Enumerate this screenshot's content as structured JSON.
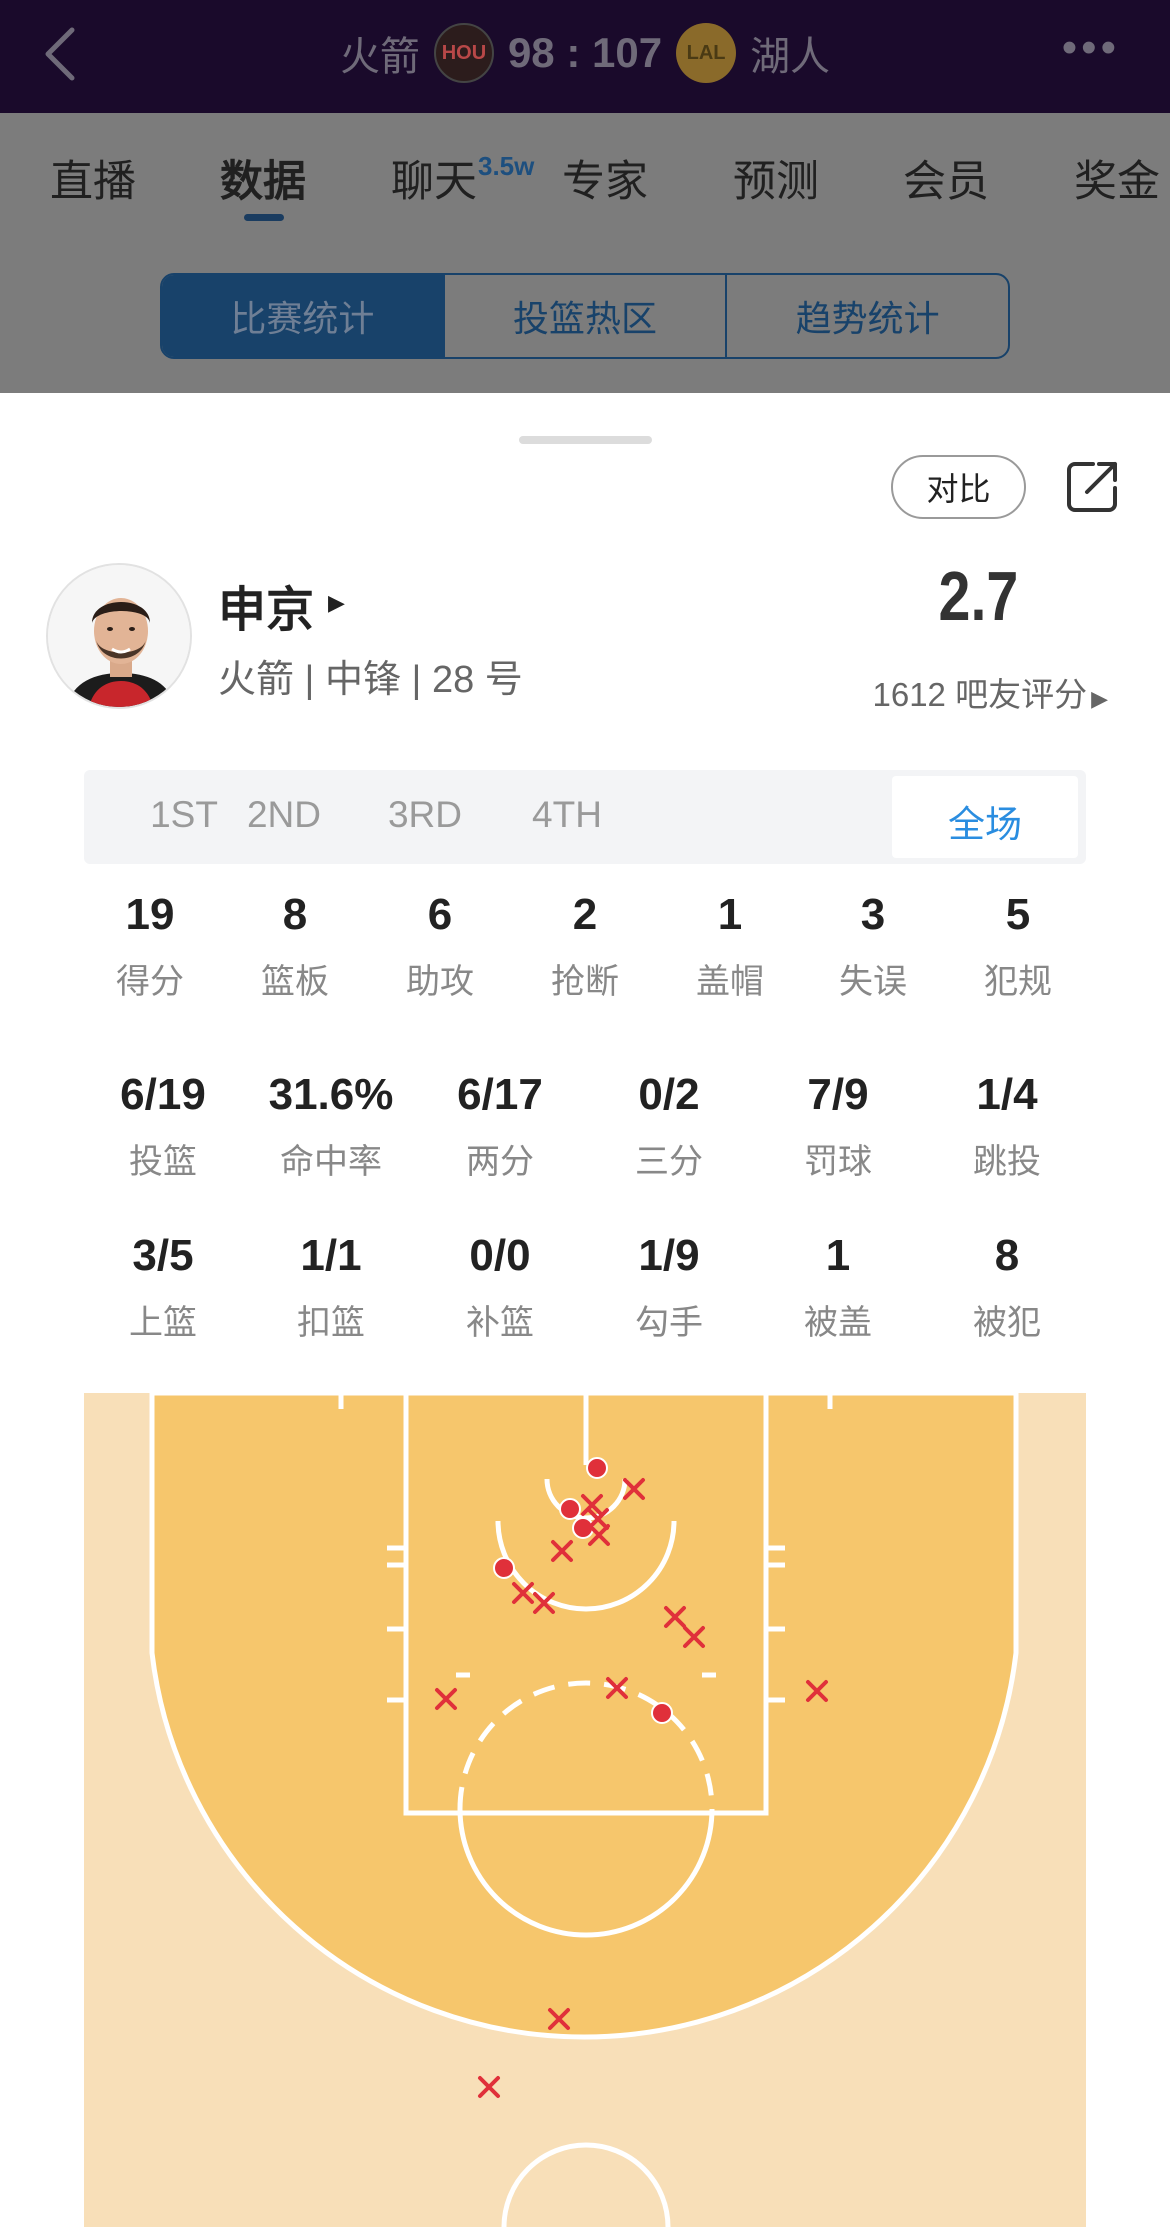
{
  "header": {
    "home_team": "火箭",
    "home_logo": "HOU",
    "away_team": "湖人",
    "away_logo": "LAL",
    "score": "98 : 107"
  },
  "nav": {
    "tabs": [
      "直播",
      "数据",
      "聊天",
      "专家",
      "预测",
      "会员",
      "奖金"
    ],
    "chat_badge": "3.5w",
    "active_index": 1
  },
  "segment": {
    "items": [
      "比赛统计",
      "投篮热区",
      "趋势统计"
    ],
    "active_index": 0
  },
  "sheet": {
    "compare_label": "对比"
  },
  "player": {
    "name": "申京",
    "info": "火箭 | 中锋 | 28 号",
    "rating": "2.7",
    "rating_count": "1612 吧友评分"
  },
  "periods": {
    "items": [
      "1ST",
      "2ND",
      "3RD",
      "4TH",
      "全场"
    ],
    "active_index": 4
  },
  "stats_row1": [
    {
      "value": "19",
      "label": "得分"
    },
    {
      "value": "8",
      "label": "篮板"
    },
    {
      "value": "6",
      "label": "助攻"
    },
    {
      "value": "2",
      "label": "抢断"
    },
    {
      "value": "1",
      "label": "盖帽"
    },
    {
      "value": "3",
      "label": "失误"
    },
    {
      "value": "5",
      "label": "犯规"
    }
  ],
  "stats_row2": [
    {
      "value": "6/19",
      "label": "投篮"
    },
    {
      "value": "31.6%",
      "label": "命中率"
    },
    {
      "value": "6/17",
      "label": "两分"
    },
    {
      "value": "0/2",
      "label": "三分"
    },
    {
      "value": "7/9",
      "label": "罚球"
    },
    {
      "value": "1/4",
      "label": "跳投"
    }
  ],
  "stats_row3": [
    {
      "value": "3/5",
      "label": "上篮"
    },
    {
      "value": "1/1",
      "label": "扣篮"
    },
    {
      "value": "0/0",
      "label": "补篮"
    },
    {
      "value": "1/9",
      "label": "勾手"
    },
    {
      "value": "1",
      "label": "被盖"
    },
    {
      "value": "8",
      "label": "被犯"
    }
  ],
  "colors": {
    "court_paint": "#f6c66c",
    "court_outer": "#f8dfb8",
    "made": "#e0303a",
    "missed": "#e0303a",
    "accent": "#2a8de0"
  }
}
